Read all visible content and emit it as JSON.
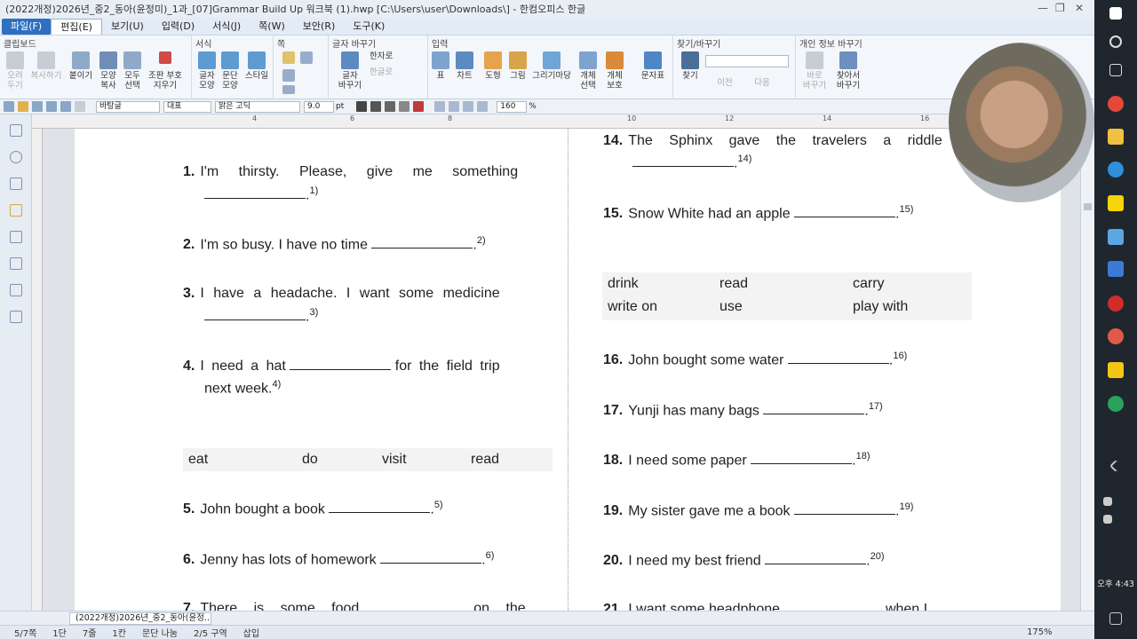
{
  "window": {
    "title": "(2022개정)2026년_중2_동아(윤정미)_1과_[07]Grammar Build Up 워크북 (1).hwp [C:\\Users\\user\\Downloads\\] - 한컴오피스 한글"
  },
  "menu": {
    "file": "파일(F)",
    "edit": "편집(E)",
    "view": "보기(U)",
    "insert": "입력(D)",
    "format": "서식(J)",
    "page": "쪽(W)",
    "security": "보안(R)",
    "tools": "도구(K)"
  },
  "ribbon": {
    "groups": {
      "clipboard": "클립보드",
      "format": "서식",
      "page": "쪽",
      "glyph_change": "글자 바꾸기",
      "insert": "입력",
      "find_replace": "찾기/바꾸기",
      "privacy": "개인 정보 바꾸기"
    },
    "buttons": {
      "cut": "오려\n두기",
      "copy": "복사하기",
      "paste": "붙이기",
      "format_copy": "모양\n복사",
      "select_all": "모두\n선택",
      "clear_cond": "조판 부호\n지우기",
      "char_shape": "글자\n모양",
      "para_shape": "문단\n모양",
      "style": "스타일",
      "hanja": "한자로",
      "hangul": "한글로",
      "glyph_change_btn": "글자\n바꾸기",
      "table": "표",
      "chart": "차트",
      "shape": "도형",
      "picture": "그림",
      "drawing_market": "그리기마당",
      "object_select": "개체\n선택",
      "object_protect": "개체\n보호",
      "symbol": "문자표",
      "find": "찾기",
      "prev": "이전",
      "next": "다음",
      "now_change": "바로\n바꾸기",
      "find_change": "찾아서\n바꾸기"
    }
  },
  "toolbar": {
    "style_combo": "바탕글",
    "lang_combo": "대표",
    "font_combo": "맑은 고딕",
    "font_size": "9.0",
    "size_unit": "pt",
    "zoom": "160",
    "zoom_unit": "%"
  },
  "ruler_ticks": [
    "4",
    "6",
    "8",
    "10",
    "12",
    "14",
    "16"
  ],
  "left_column": {
    "items": [
      {
        "num": "1.",
        "text": "I'm thirsty. Please, give me something",
        "line2": "",
        "ref": "1)"
      },
      {
        "num": "2.",
        "text": "I'm so busy. I have no time",
        "ref": "2)"
      },
      {
        "num": "3.",
        "text": "I have a headache. I want some medicine",
        "ref": "3)"
      },
      {
        "num": "4.",
        "text": "I need a hat",
        "text_after": "for the field trip",
        "line2": "next week.",
        "ref": "4)"
      },
      {
        "num": "5.",
        "text": "John bought a book",
        "ref": "5)"
      },
      {
        "num": "6.",
        "text": "Jenny has lots of homework",
        "ref": "6)"
      },
      {
        "num": "7.",
        "text": "There is some food",
        "text_after": "on the"
      }
    ],
    "word_box": [
      "eat",
      "do",
      "visit",
      "read"
    ]
  },
  "right_column": {
    "items": [
      {
        "num": "14.",
        "text": "The Sphinx gave the travelers a riddle",
        "ref": "14)"
      },
      {
        "num": "15.",
        "text": "Snow White had an apple",
        "ref": "15)"
      },
      {
        "num": "16.",
        "text": "John bought some water",
        "ref": "16)"
      },
      {
        "num": "17.",
        "text": "Yunji has many bags",
        "ref": "17)"
      },
      {
        "num": "18.",
        "text": "I need some paper",
        "ref": "18)"
      },
      {
        "num": "19.",
        "text": "My sister gave me a book",
        "ref": "19)"
      },
      {
        "num": "20.",
        "text": "I need my best friend",
        "ref": "20)"
      },
      {
        "num": "21.",
        "text": "I want some headphone",
        "text_after": "when I"
      }
    ],
    "word_box": [
      [
        "drink",
        "read",
        "carry"
      ],
      [
        "write on",
        "use",
        "play with"
      ]
    ]
  },
  "tab": {
    "doc_tab": "(2022개정)2026년_중2_동아(윤정..."
  },
  "status": {
    "page": "5/7쪽",
    "section": "1단",
    "line": "7줄",
    "col": "1칸",
    "para_break": "문단 나눔",
    "zone": "2/5 구역",
    "mode": "삽입",
    "zoom": "175%"
  },
  "taskbar": {
    "time": "오후 4:43"
  },
  "colors": {
    "accent": "#2f6fc1",
    "taskbar_bg": "#20262d",
    "word_box_bg": "#f3f3f3"
  }
}
